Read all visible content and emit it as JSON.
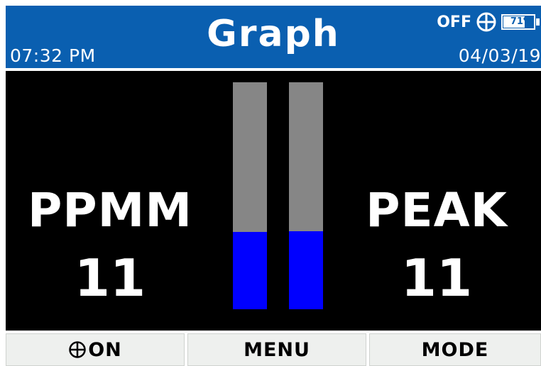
{
  "header": {
    "time": "07:32 PM",
    "title": "Graph",
    "date": "04/03/19",
    "gps_status": "OFF",
    "gps_icon": "crosshair-circle-icon",
    "battery_percent_label": "71%",
    "battery_level": 0.71
  },
  "readings": {
    "ppmm": {
      "label": "PPMM",
      "value": "11",
      "bar_level": 0.34
    },
    "peak": {
      "label": "PEAK",
      "value": "11",
      "bar_level": 0.345
    }
  },
  "softkeys": {
    "left_label": "ON",
    "left_icon": "crosshair-circle-icon",
    "middle_label": "MENU",
    "right_label": "MODE"
  },
  "colors": {
    "header_bg": "#0a5fb0",
    "bar_track": "#868686",
    "bar_fill": "#0000ff",
    "softkey_bg": "#eef0ee"
  }
}
